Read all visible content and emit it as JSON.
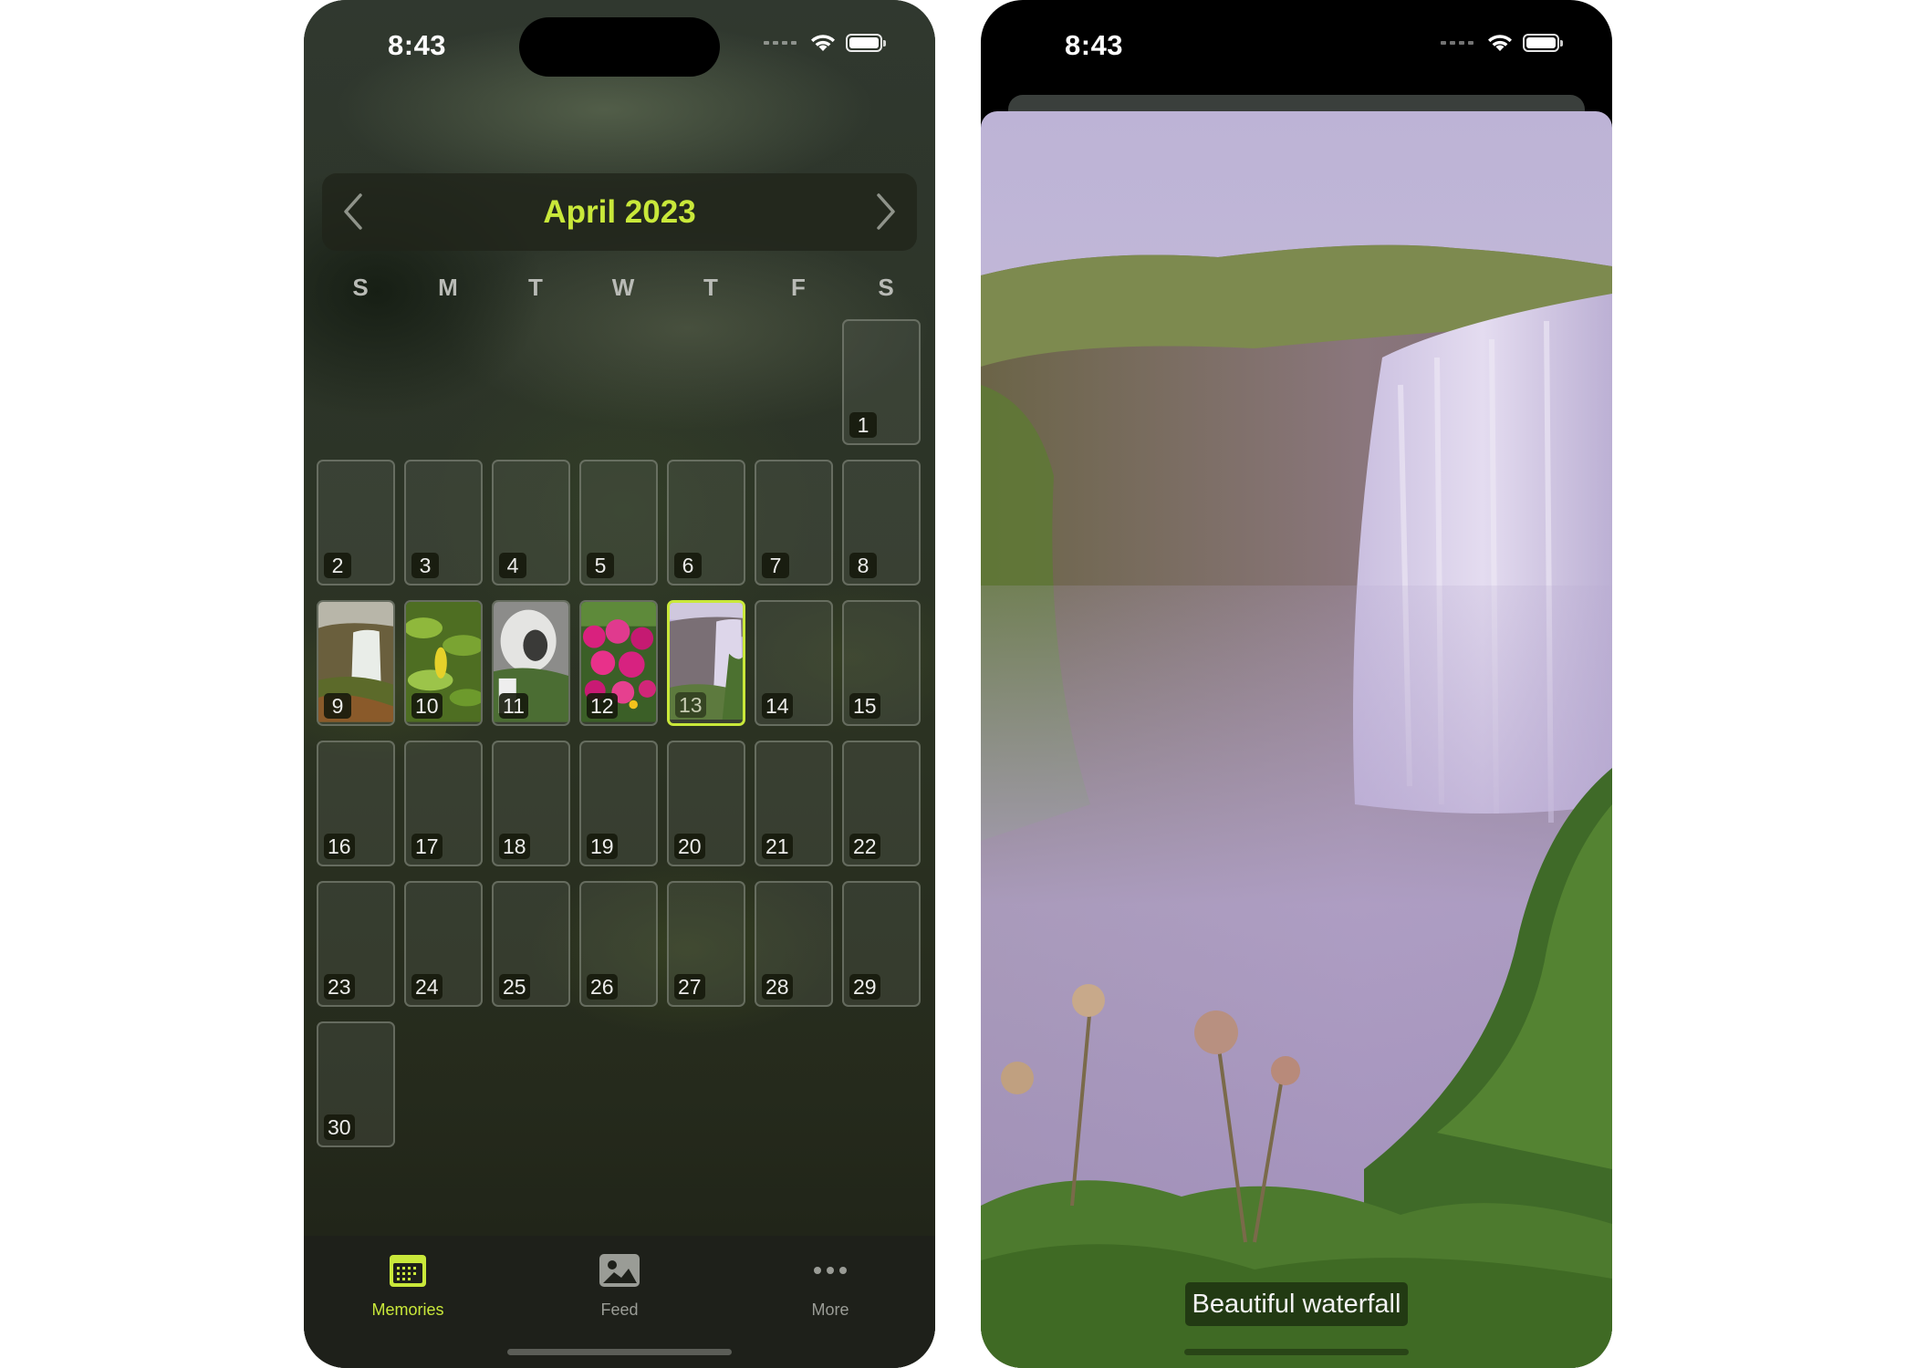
{
  "left_screen": {
    "status_time": "8:43",
    "month_title": "April 2023",
    "weekdays": [
      "S",
      "M",
      "T",
      "W",
      "T",
      "F",
      "S"
    ],
    "days": [
      "1",
      "2",
      "3",
      "4",
      "5",
      "6",
      "7",
      "8",
      "9",
      "10",
      "11",
      "12",
      "13",
      "14",
      "15",
      "16",
      "17",
      "18",
      "19",
      "20",
      "21",
      "22",
      "23",
      "24",
      "25",
      "26",
      "27",
      "28",
      "29",
      "30"
    ],
    "photo_days": [
      "9",
      "10",
      "11",
      "12",
      "13"
    ],
    "selected_day": "13",
    "tabs": [
      {
        "label": "Memories",
        "icon": "calendar-icon",
        "active": true
      },
      {
        "label": "Feed",
        "icon": "photo-icon",
        "active": false
      },
      {
        "label": "More",
        "icon": "ellipsis-icon",
        "active": false
      }
    ]
  },
  "right_screen": {
    "status_time": "8:43",
    "caption": "Beautiful waterfall"
  },
  "colors": {
    "accent": "#c9e83a",
    "tabbar": "#1e201a"
  }
}
